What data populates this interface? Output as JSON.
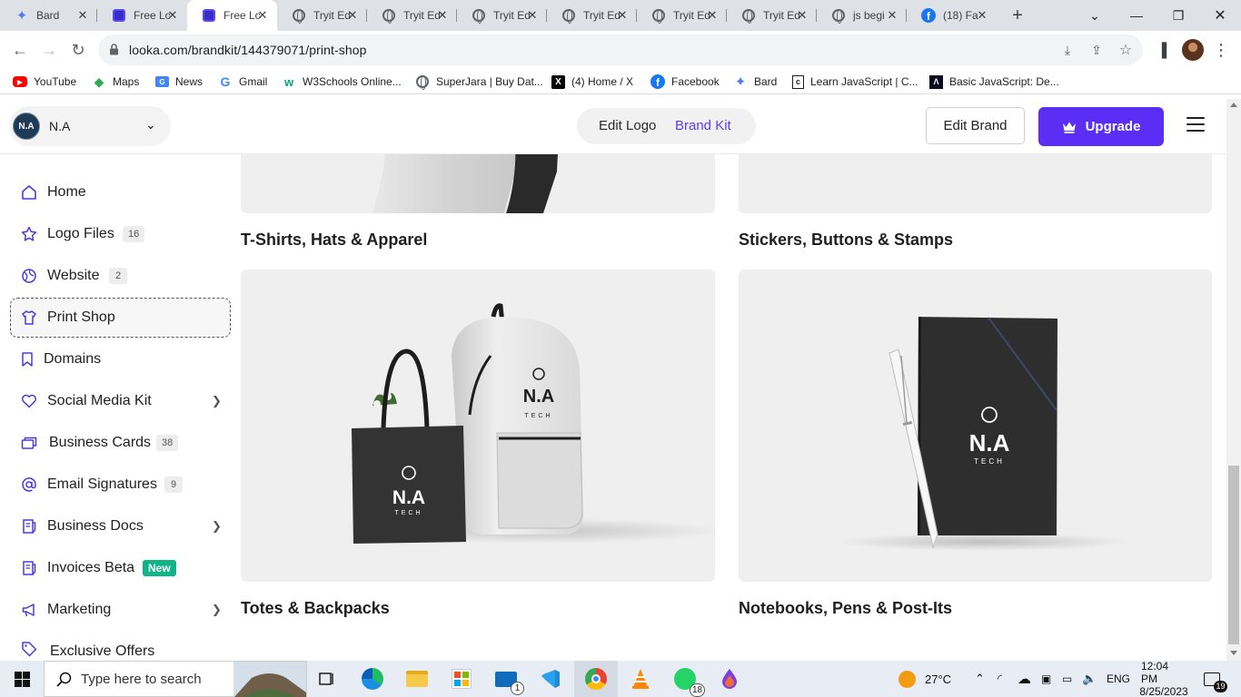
{
  "browser": {
    "tabs": [
      {
        "title": "Bard",
        "icon": "bard-icon",
        "active": false
      },
      {
        "title": "Free Lo",
        "icon": "looka-icon",
        "active": false
      },
      {
        "title": "Free Lo",
        "icon": "looka-icon",
        "active": true
      },
      {
        "title": "Tryit Ed",
        "icon": "globe-icon",
        "active": false
      },
      {
        "title": "Tryit Ed",
        "icon": "globe-icon",
        "active": false
      },
      {
        "title": "Tryit Ed",
        "icon": "globe-icon",
        "active": false
      },
      {
        "title": "Tryit Ed",
        "icon": "globe-icon",
        "active": false
      },
      {
        "title": "Tryit Ed",
        "icon": "globe-icon",
        "active": false
      },
      {
        "title": "Tryit Ed",
        "icon": "globe-icon",
        "active": false
      },
      {
        "title": "js begi",
        "icon": "globe-icon",
        "active": false
      },
      {
        "title": "(18) Fa",
        "icon": "facebook-icon",
        "active": false
      }
    ],
    "url": "looka.com/brandkit/144379071/print-shop",
    "bookmarks": [
      {
        "label": "YouTube",
        "icon": "youtube-icon"
      },
      {
        "label": "Maps",
        "icon": "maps-icon"
      },
      {
        "label": "News",
        "icon": "news-icon"
      },
      {
        "label": "Gmail",
        "icon": "google-icon"
      },
      {
        "label": "W3Schools Online...",
        "icon": "w3schools-icon"
      },
      {
        "label": "SuperJara | Buy Dat...",
        "icon": "globe-icon"
      },
      {
        "label": "(4) Home / X",
        "icon": "x-icon"
      },
      {
        "label": "Facebook",
        "icon": "facebook-icon"
      },
      {
        "label": "Bard",
        "icon": "bard-icon"
      },
      {
        "label": "Learn JavaScript | C...",
        "icon": "codecademy-icon"
      },
      {
        "label": "Basic JavaScript: De...",
        "icon": "freecodecamp-icon"
      }
    ]
  },
  "header": {
    "brand_name": "N.A",
    "brand_initials": "N.A",
    "mode_edit_logo": "Edit Logo",
    "mode_brand_kit": "Brand Kit",
    "edit_brand": "Edit Brand",
    "upgrade": "Upgrade"
  },
  "sidebar": {
    "items": [
      {
        "label": "Home",
        "icon": "home-icon"
      },
      {
        "label": "Logo Files",
        "icon": "star-icon",
        "badge": "16"
      },
      {
        "label": "Website",
        "icon": "globe-icon",
        "badge": "2"
      },
      {
        "label": "Print Shop",
        "icon": "shirt-icon",
        "active": true
      },
      {
        "label": "Domains",
        "icon": "bookmark-icon"
      },
      {
        "label": "Social Media Kit",
        "icon": "heart-icon",
        "chevron": true
      },
      {
        "label": "Business Cards",
        "icon": "cards-icon",
        "badge": "38"
      },
      {
        "label": "Email Signatures",
        "icon": "at-icon",
        "badge": "9"
      },
      {
        "label": "Business Docs",
        "icon": "doc-icon",
        "chevron": true
      },
      {
        "label": "Invoices Beta",
        "icon": "invoice-icon",
        "new_badge": "New"
      },
      {
        "label": "Marketing",
        "icon": "megaphone-icon",
        "chevron": true
      },
      {
        "label": "Exclusive Offers",
        "icon": "tag-icon"
      }
    ]
  },
  "products": [
    {
      "title": "T-Shirts, Hats & Apparel"
    },
    {
      "title": "Stickers, Buttons & Stamps"
    },
    {
      "title": "Totes & Backpacks"
    },
    {
      "title": "Notebooks, Pens & Post-Its"
    }
  ],
  "mockup": {
    "logo_text": "N.A",
    "logo_subtext": "TECH"
  },
  "taskbar": {
    "search_placeholder": "Type here to search",
    "weather": "27°C",
    "language": "ENG",
    "time": "12:04 PM",
    "date": "8/25/2023",
    "notifications": "19",
    "mail_badge": "1",
    "whatsapp_badge": "18"
  },
  "colors": {
    "accent": "#5b2ef5",
    "brand_kit_link": "#5b3cf5",
    "new_badge": "#11b388"
  }
}
